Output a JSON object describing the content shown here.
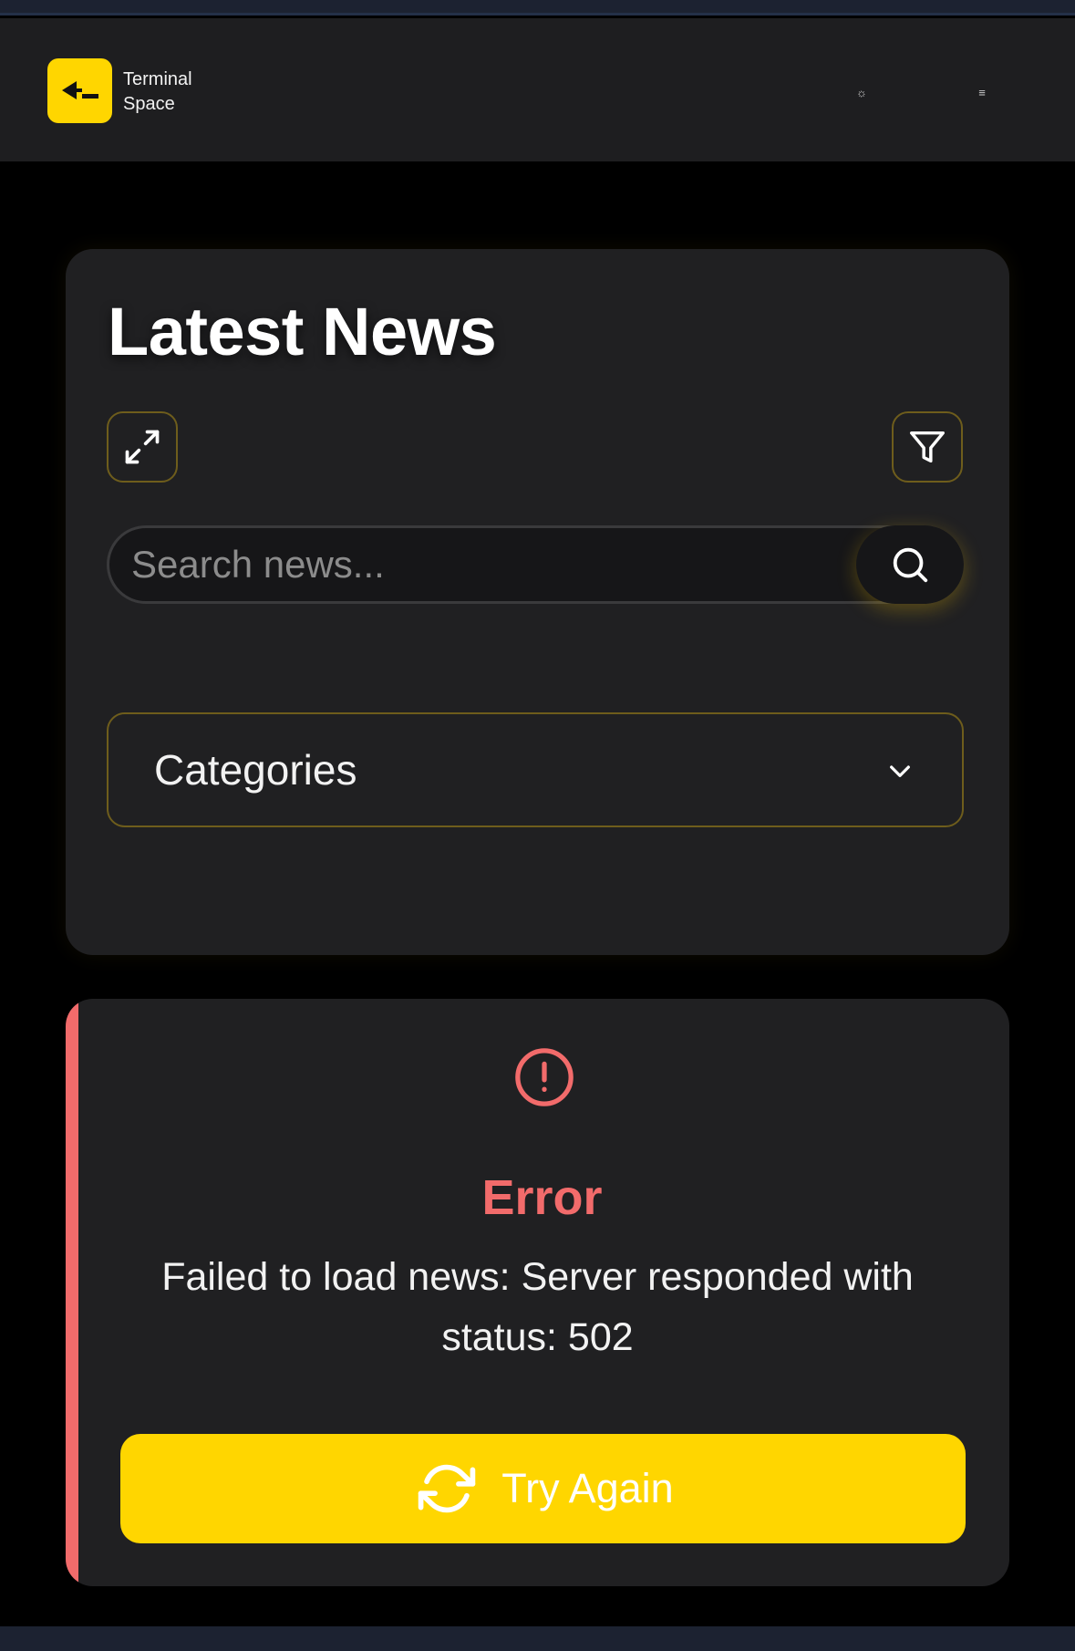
{
  "header": {
    "logo_line1": "Terminal",
    "logo_line2": "Space",
    "theme_icon": "sun-icon",
    "theme_glyph": "☼",
    "menu_icon": "menu-icon",
    "menu_glyph": "≡"
  },
  "news": {
    "title": "Latest News",
    "search_placeholder": "Search news...",
    "categories_label": "Categories"
  },
  "error": {
    "title": "Error",
    "message": "Failed to load news: Server responded with status: 502",
    "retry_label": "Try Again"
  },
  "colors": {
    "accent": "#ffd600",
    "error": "#f26b6b",
    "card": "#202022",
    "header": "#1e1e20"
  }
}
